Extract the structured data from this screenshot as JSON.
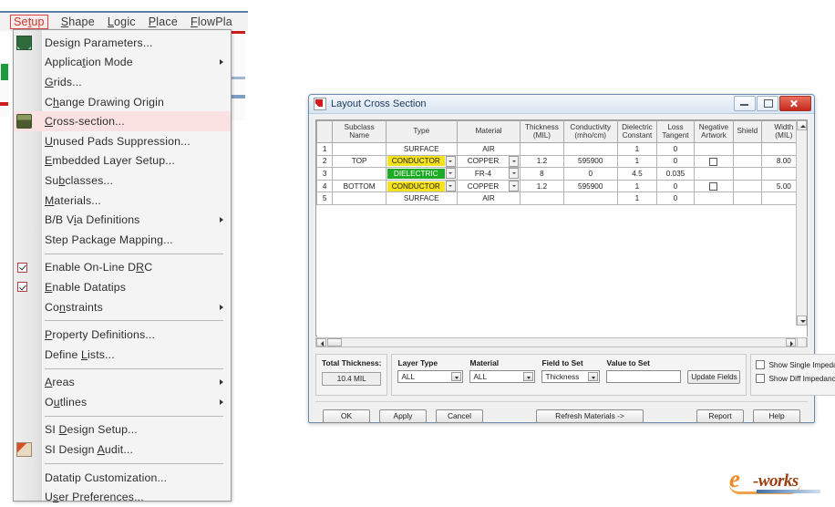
{
  "menubar": {
    "items": [
      {
        "label": "Setup",
        "active": true
      },
      {
        "label": "Shape",
        "active": false
      },
      {
        "label": "Logic",
        "active": false
      },
      {
        "label": "Place",
        "active": false
      },
      {
        "label": "FlowPla",
        "active": false
      }
    ]
  },
  "setup_menu": {
    "items": [
      {
        "label": "Design Parameters...",
        "icon": "design-parameters-icon",
        "submenu": false,
        "checked": null,
        "highlighted": false
      },
      {
        "label": "Application Mode",
        "icon": null,
        "submenu": true,
        "checked": null,
        "highlighted": false
      },
      {
        "label": "Grids...",
        "icon": null,
        "submenu": false,
        "checked": null,
        "highlighted": false
      },
      {
        "label": "Change Drawing Origin",
        "icon": null,
        "submenu": false,
        "checked": null,
        "highlighted": false
      },
      {
        "label": "Cross-section...",
        "icon": "cross-section-icon",
        "submenu": false,
        "checked": null,
        "highlighted": true
      },
      {
        "label": "Unused Pads Suppression...",
        "icon": null,
        "submenu": false,
        "checked": null,
        "highlighted": false
      },
      {
        "label": "Embedded Layer Setup...",
        "icon": null,
        "submenu": false,
        "checked": null,
        "highlighted": false
      },
      {
        "label": "Subclasses...",
        "icon": null,
        "submenu": false,
        "checked": null,
        "highlighted": false
      },
      {
        "label": "Materials...",
        "icon": null,
        "submenu": false,
        "checked": null,
        "highlighted": false
      },
      {
        "label": "B/B Via Definitions",
        "icon": null,
        "submenu": true,
        "checked": null,
        "highlighted": false
      },
      {
        "label": "Step Package Mapping...",
        "icon": null,
        "submenu": false,
        "checked": null,
        "highlighted": false
      },
      {
        "separator": true
      },
      {
        "label": "Enable On-Line DRC",
        "icon": null,
        "submenu": false,
        "checked": true,
        "highlighted": false
      },
      {
        "label": "Enable Datatips",
        "icon": null,
        "submenu": false,
        "checked": true,
        "highlighted": false
      },
      {
        "label": "Constraints",
        "icon": null,
        "submenu": true,
        "checked": null,
        "highlighted": false
      },
      {
        "separator": true
      },
      {
        "label": "Property Definitions...",
        "icon": null,
        "submenu": false,
        "checked": null,
        "highlighted": false
      },
      {
        "label": "Define Lists...",
        "icon": null,
        "submenu": false,
        "checked": null,
        "highlighted": false
      },
      {
        "separator": true
      },
      {
        "label": "Areas",
        "icon": null,
        "submenu": true,
        "checked": null,
        "highlighted": false
      },
      {
        "label": "Outlines",
        "icon": null,
        "submenu": true,
        "checked": null,
        "highlighted": false
      },
      {
        "separator": true
      },
      {
        "label": "SI Design Setup...",
        "icon": null,
        "submenu": false,
        "checked": null,
        "highlighted": false
      },
      {
        "label": "SI Design Audit...",
        "icon": "si-design-audit-icon",
        "submenu": false,
        "checked": null,
        "highlighted": false
      },
      {
        "separator": true
      },
      {
        "label": "Datatip Customization...",
        "icon": null,
        "submenu": false,
        "checked": null,
        "highlighted": false
      },
      {
        "label": "User Preferences...",
        "icon": null,
        "submenu": false,
        "checked": null,
        "highlighted": false
      }
    ]
  },
  "dialog": {
    "title": "Layout Cross Section",
    "window_buttons": [
      "minimize",
      "maximize",
      "close"
    ],
    "table": {
      "columns": [
        {
          "line1": "",
          "line2": ""
        },
        {
          "line1": "Subclass Name",
          "line2": ""
        },
        {
          "line1": "Type",
          "line2": ""
        },
        {
          "line1": "Material",
          "line2": ""
        },
        {
          "line1": "Thickness",
          "line2": "(MIL)"
        },
        {
          "line1": "Conductivity",
          "line2": "(mho/cm)"
        },
        {
          "line1": "Dielectric",
          "line2": "Constant"
        },
        {
          "line1": "Loss",
          "line2": "Tangent"
        },
        {
          "line1": "Negative",
          "line2": "Artwork"
        },
        {
          "line1": "Shield",
          "line2": ""
        },
        {
          "line1": "Width",
          "line2": "(MIL)"
        }
      ],
      "rows": [
        {
          "no": "1",
          "subclass": "",
          "type": "SURFACE",
          "type_style": "plain",
          "type_dropdown": false,
          "material": "AIR",
          "material_dropdown": false,
          "thickness": "",
          "conductivity": "",
          "dielectric": "1",
          "loss": "0",
          "negative": false,
          "shield": "",
          "width": ""
        },
        {
          "no": "2",
          "subclass": "TOP",
          "type": "CONDUCTOR",
          "type_style": "yellow",
          "type_dropdown": true,
          "material": "COPPER",
          "material_dropdown": true,
          "thickness": "1.2",
          "conductivity": "595900",
          "dielectric": "1",
          "loss": "0",
          "negative": true,
          "shield": "",
          "width": "8.00"
        },
        {
          "no": "3",
          "subclass": "",
          "type": "DIELECTRIC",
          "type_style": "green",
          "type_dropdown": true,
          "material": "FR-4",
          "material_dropdown": true,
          "thickness": "8",
          "conductivity": "0",
          "dielectric": "4.5",
          "loss": "0.035",
          "negative": false,
          "shield": "",
          "width": ""
        },
        {
          "no": "4",
          "subclass": "BOTTOM",
          "type": "CONDUCTOR",
          "type_style": "yellow",
          "type_dropdown": true,
          "material": "COPPER",
          "material_dropdown": true,
          "thickness": "1.2",
          "conductivity": "595900",
          "dielectric": "1",
          "loss": "0",
          "negative": true,
          "shield": "",
          "width": "5.00"
        },
        {
          "no": "5",
          "subclass": "",
          "type": "SURFACE",
          "type_style": "plain",
          "type_dropdown": false,
          "material": "AIR",
          "material_dropdown": false,
          "thickness": "",
          "conductivity": "",
          "dielectric": "1",
          "loss": "0",
          "negative": false,
          "shield": "",
          "width": ""
        }
      ]
    },
    "total_thickness": {
      "label": "Total Thickness:",
      "value": "10.4 MIL"
    },
    "fields": {
      "layer_type": {
        "label": "Layer Type",
        "value": "ALL"
      },
      "material": {
        "label": "Material",
        "value": "ALL"
      },
      "field_to_set": {
        "label": "Field to Set",
        "value": "Thickness"
      },
      "value_to_set": {
        "label": "Value to Set",
        "value": ""
      },
      "update_fields_label": "Update Fields"
    },
    "checkboxes": [
      {
        "label": "Show Single Impedance",
        "checked": false
      },
      {
        "label": "Show Diff Impedance",
        "checked": false
      }
    ],
    "buttons": {
      "ok": "OK",
      "apply": "Apply",
      "cancel": "Cancel",
      "refresh": "Refresh Materials ->",
      "report": "Report",
      "help": "Help"
    }
  },
  "logo": {
    "e": "e",
    "works": "-works"
  }
}
